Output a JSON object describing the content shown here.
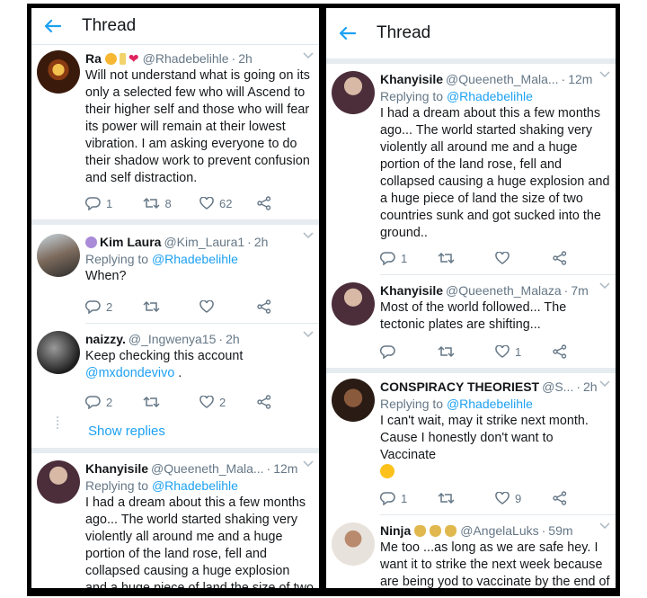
{
  "colors": {
    "accent": "#1da1f2",
    "muted": "#657786",
    "text": "#14171a",
    "divider": "#e6ecf0"
  },
  "left": {
    "title": "Thread",
    "tweets": [
      {
        "name": "Ra",
        "handle": "@Rhadebelihle",
        "time": "2h",
        "reply_prefix": "",
        "reply_to": "",
        "text": "Will not understand what is going on its only a selected few who will Ascend to their higher self and those who will fear its power will remain at their lowest vibration. I am asking everyone to do their shadow work to prevent confusion and self distraction.",
        "replies": "1",
        "retweets": "8",
        "likes": "62"
      },
      {
        "name": "Kim Laura",
        "handle": "@Kim_Laura1",
        "time": "2h",
        "reply_prefix": "Replying to ",
        "reply_to": "@Rhadebelihle",
        "text": "When?",
        "replies": "2",
        "retweets": "",
        "likes": ""
      },
      {
        "name": "naizzy.",
        "handle": "@_Ingwenya15",
        "time": "2h",
        "reply_prefix": "",
        "reply_to": "",
        "text": "Keep checking this account",
        "text_link": "@mxdondevivo",
        "text_tail": " .",
        "replies": "2",
        "retweets": "",
        "likes": "2"
      },
      {
        "name": "Khanyisile",
        "handle": "@Queeneth_Mala...",
        "time": "12m",
        "reply_prefix": "Replying to ",
        "reply_to": "@Rhadebelihle",
        "text": "I had a dream about this a few months ago... The world started shaking very violently all around me and a huge portion of the land rose, fell and collapsed causing a huge explosion and a huge piece of land the size of two"
      }
    ],
    "show_replies": "Show replies"
  },
  "right": {
    "title": "Thread",
    "tweets": [
      {
        "name": "Khanyisile",
        "handle": "@Queeneth_Mala...",
        "time": "12m",
        "reply_prefix": "Replying to ",
        "reply_to": "@Rhadebelihle",
        "text": "I had a dream about this a few months ago... The world started shaking very violently all around me and a huge portion of the land rose, fell and collapsed causing a huge explosion and a huge piece of land the size of two countries sunk and got sucked into the ground..",
        "replies": "1",
        "retweets": "",
        "likes": ""
      },
      {
        "name": "Khanyisile",
        "handle": "@Queeneth_Malaza",
        "time": "7m",
        "reply_prefix": "",
        "reply_to": "",
        "text": "Most of the world followed... The tectonic plates are shifting...",
        "replies": "",
        "retweets": "",
        "likes": "1"
      },
      {
        "name": "CONSPIRACY THEORIEST",
        "handle": "@S...",
        "time": "2h",
        "reply_prefix": "Replying to ",
        "reply_to": "@Rhadebelihle",
        "text": "I can't wait, may it strike next month. Cause I honestly don't want to Vaccinate",
        "replies": "1",
        "retweets": "",
        "likes": "9"
      },
      {
        "name": "Ninja",
        "handle": "@AngelaLuks",
        "time": "59m",
        "reply_prefix": "",
        "reply_to": "",
        "text": "Me too ...as long as we are safe hey.  I want it to strike the next week because are being yod to vaccinate by the end of October"
      }
    ]
  }
}
